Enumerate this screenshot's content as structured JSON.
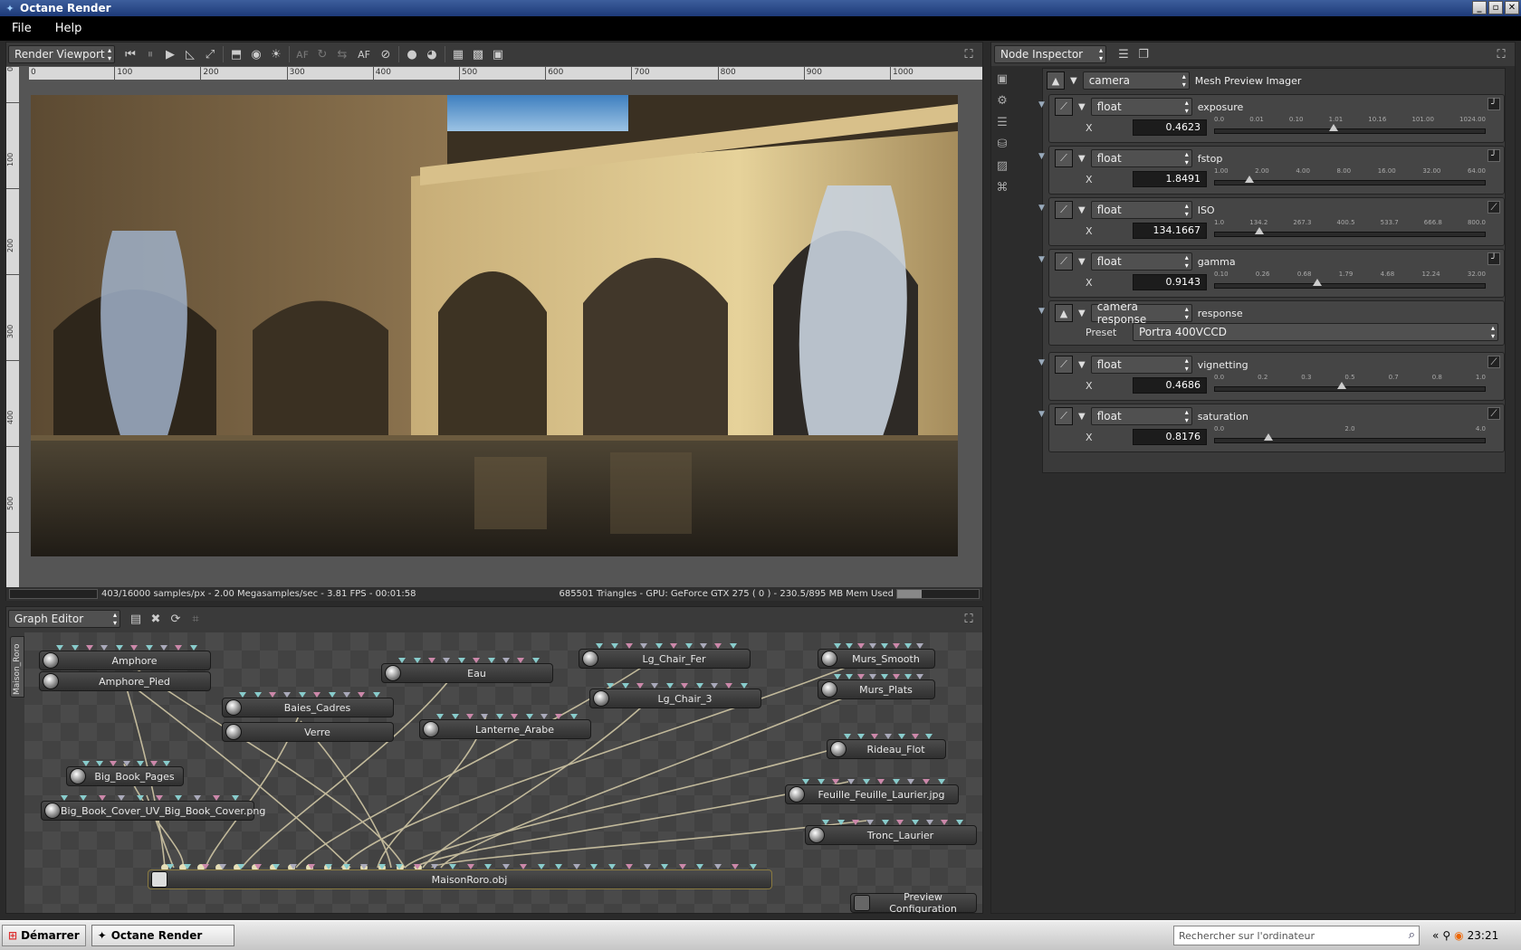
{
  "window": {
    "title": "Octane Render"
  },
  "menu": {
    "file": "File",
    "help": "Help"
  },
  "viewport": {
    "panel_label": "Render Viewport",
    "af_label": "AF",
    "ruler_top": [
      "0",
      "100",
      "200",
      "300",
      "400",
      "500",
      "600",
      "700",
      "800",
      "900",
      "1000"
    ],
    "ruler_left": [
      "0",
      "100",
      "200",
      "300",
      "400",
      "500"
    ],
    "status_left": "403/16000 samples/px - 2.00 Megasamples/sec - 3.81 FPS - 00:01:58",
    "status_right": "685501 Triangles - GPU: GeForce GTX 275 ( 0 ) - 230.5/895 MB Mem Used"
  },
  "graph": {
    "panel_label": "Graph Editor",
    "side_tab": "Maison_Roro",
    "nodes": {
      "amphore": "Amphore",
      "amphore_pied": "Amphore_Pied",
      "eau": "Eau",
      "lg_chair_fer": "Lg_Chair_Fer",
      "murs_smooth": "Murs_Smooth",
      "murs_plats": "Murs_Plats",
      "lg_chair_3": "Lg_Chair_3",
      "baies_cadres": "Baies_Cadres",
      "verre": "Verre",
      "lanterne_arabe": "Lanterne_Arabe",
      "rideau_flot": "Rideau_Flot",
      "big_book_pages": "Big_Book_Pages",
      "big_book_cover": "Big_Book_Cover_UV_Big_Book_Cover.png",
      "feuille": "Feuille_Feuille_Laurier.jpg",
      "tronc": "Tronc_Laurier",
      "maison": "MaisonRoro.obj",
      "preview": "Preview Configuration"
    }
  },
  "inspector": {
    "panel_label": "Node Inspector",
    "camera_type": "camera",
    "camera_title": "Mesh Preview Imager",
    "x_label": "X",
    "preset_label": "Preset",
    "params": [
      {
        "type": "float",
        "name": "exposure",
        "value": "0.4623",
        "ticks": [
          "0.0",
          "0.01",
          "0.10",
          "1.01",
          "10.16",
          "101.00",
          "1024.00"
        ],
        "pos": 0.44
      },
      {
        "type": "float",
        "name": "fstop",
        "value": "1.8491",
        "ticks": [
          "1.00",
          "2.00",
          "4.00",
          "8.00",
          "16.00",
          "32.00",
          "64.00"
        ],
        "pos": 0.13
      },
      {
        "type": "float",
        "name": "ISO",
        "value": "134.1667",
        "ticks": [
          "1.0",
          "134.2",
          "267.3",
          "400.5",
          "533.7",
          "666.8",
          "800.0"
        ],
        "pos": 0.165
      },
      {
        "type": "float",
        "name": "gamma",
        "value": "0.9143",
        "ticks": [
          "0.10",
          "0.26",
          "0.68",
          "1.79",
          "4.68",
          "12.24",
          "32.00"
        ],
        "pos": 0.38
      },
      {
        "type": "float",
        "name": "vignetting",
        "value": "0.4686",
        "ticks": [
          "0.0",
          "0.2",
          "0.3",
          "0.5",
          "0.7",
          "0.8",
          "1.0"
        ],
        "pos": 0.47
      },
      {
        "type": "float",
        "name": "saturation",
        "value": "0.8176",
        "ticks": [
          "0.0",
          "2.0",
          "4.0"
        ],
        "pos": 0.2
      }
    ],
    "response": {
      "type": "camera response",
      "name": "response",
      "preset": "Portra 400VCCD"
    }
  },
  "taskbar": {
    "start": "Démarrer",
    "task": "Octane Render",
    "search_placeholder": "Rechercher sur l'ordinateur",
    "clock": "23:21"
  }
}
